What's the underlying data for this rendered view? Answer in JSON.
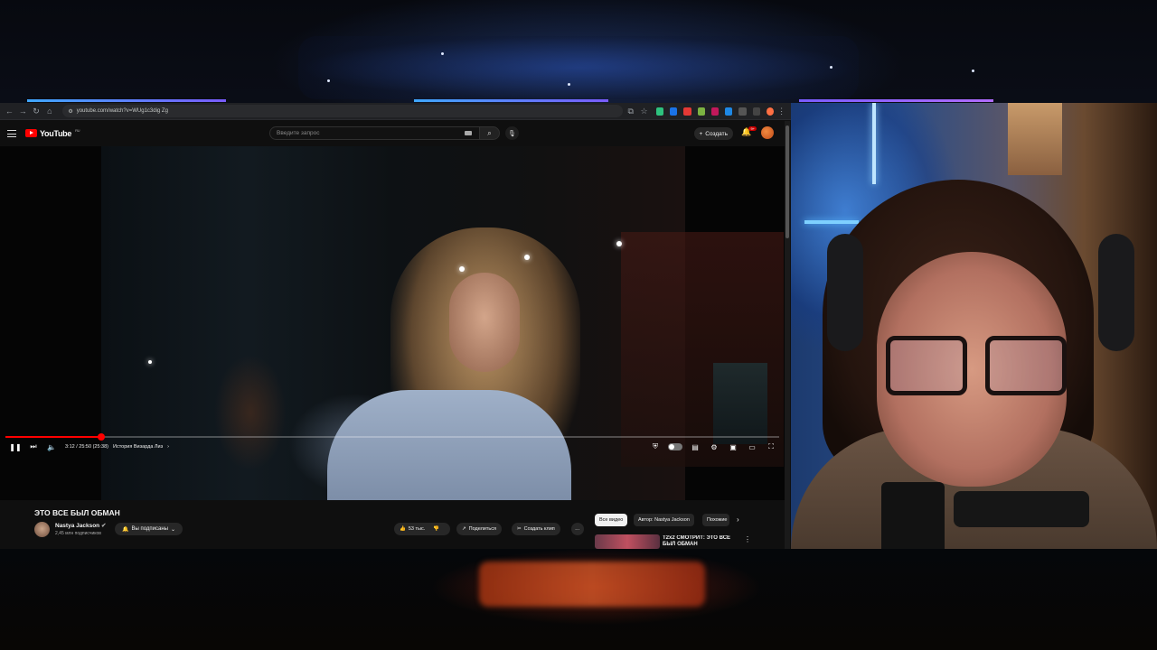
{
  "browser": {
    "url": "youtube.com/watch?v=WUg1c3dig Zg",
    "extension_colors": [
      "#2ec27e",
      "#1a73e8",
      "#e53935",
      "#7cb342",
      "#c2185b",
      "#1e88e5",
      "#ffffff",
      "#ff7043"
    ]
  },
  "youtube": {
    "logo_text": "YouTube",
    "region": "RU",
    "search_placeholder": "Введите запрос",
    "create_label": "Создать",
    "notification_badge": "9+"
  },
  "player": {
    "time_display": "3:12 / 25:50 (25:38)",
    "chapter": "История Визарда Лиз",
    "progress": 0.124
  },
  "video": {
    "title": "ЭТО ВСЕ БЫЛ ОБМАН",
    "channel_name": "Nastya Jackson",
    "subscribers": "2,45 млн подписчиков",
    "subscribed_label": "Вы подписаны",
    "likes": "53 тыс.",
    "share_label": "Поделиться",
    "clip_label": "Создать клип",
    "more_label": "…"
  },
  "recommendations": {
    "chips": [
      "Все видео",
      "Автор: Nastya Jackson",
      "Похожие"
    ],
    "first_title": "T2x2 СМОТРИТ: ЭТО ВСЕ БЫЛ ОБМАН"
  }
}
